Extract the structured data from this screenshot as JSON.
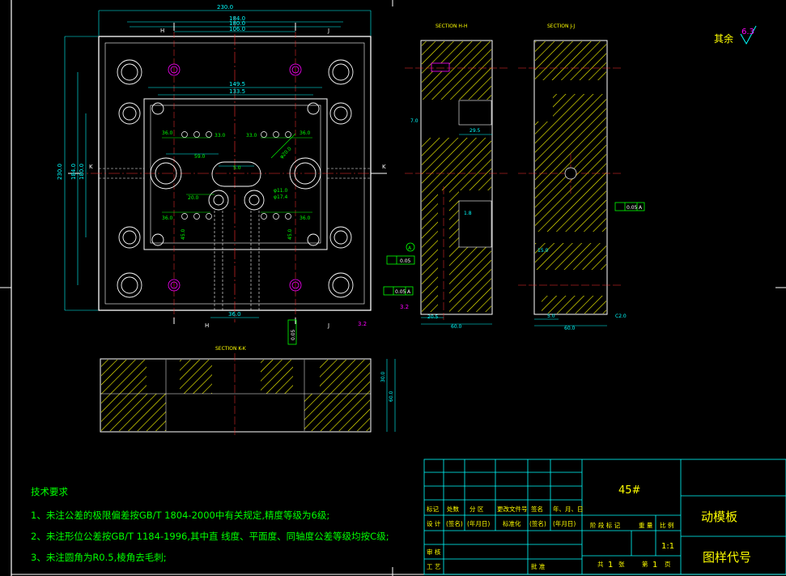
{
  "sections": {
    "hh": "SECTION H-H",
    "jj": "SECTION J-J",
    "kk": "SECTION K-K"
  },
  "markers": {
    "h": "H",
    "j": "J",
    "k": "K",
    "a": "A"
  },
  "surface": {
    "label": "其余",
    "value": "6.3"
  },
  "dims": {
    "d230": "230.0",
    "d184": "184.0",
    "d180": "180.0",
    "d106": "106.0",
    "d149": "149.5",
    "d133": "133.5",
    "l230": "230.0",
    "l184": "184.0",
    "l180": "180.0",
    "d36": "36.0",
    "d33": "33.0",
    "d59": "59.0",
    "d5": "5.0",
    "d20": "20.0",
    "d36b": "36.0",
    "d36c": "36.0",
    "d33b": "33.0",
    "d29_5": "29.5",
    "d1_8": "1.8",
    "d7": "7.0",
    "d20_5": "20.5",
    "d60": "60.0",
    "d15": "15.0",
    "d5b": "5.0",
    "d60b": "60.0",
    "c2": "C2.0",
    "d30": "30.0",
    "d60c": "60.0",
    "d36bot": "36.0",
    "dia11": "φ11.0",
    "dia17": "φ17.4",
    "dia20": "φ20.0",
    "r45a": "45.0",
    "r45b": "45.0"
  },
  "tolerances": {
    "t1": "0.05",
    "t1_ref": "A",
    "t2": "0.05",
    "t3": "0.05",
    "t3_ref": "A",
    "t4": "0.05",
    "rough_a": "3.2",
    "rough_b": "3.2",
    "rough_c": "3.2"
  },
  "notes": {
    "title": "技术要求",
    "items": [
      "1、未注公差的极限偏差按GB/T 1804-2000中有关规定,精度等级为6级;",
      "2、未注形位公差按GB/T 1184-1996,其中直 线度、平面度、同轴度公差等级均按C级;",
      "3、未注圆角为R0.5,棱角去毛刺;"
    ]
  },
  "title_block": {
    "material": "45#",
    "part_name": "动模板",
    "drawing_no": "图样代号",
    "scale": "1:1",
    "row_headers": [
      "标记",
      "处数",
      "分 区",
      "更改文件号",
      "签名",
      "年、月、日"
    ],
    "design_row": [
      "设 计",
      "(签名)",
      "(年月日)",
      "标准化",
      "(签名)",
      "(年月日)"
    ],
    "review": "审 核",
    "process": "工 艺",
    "approve": "批 准",
    "stage_headers": [
      "阶 段 标 记",
      "重 量",
      "比 例"
    ],
    "sheet": {
      "total_label": "共",
      "total": "1",
      "zhang": "张",
      "no_label": "第",
      "no": "1",
      "page": "页"
    }
  }
}
